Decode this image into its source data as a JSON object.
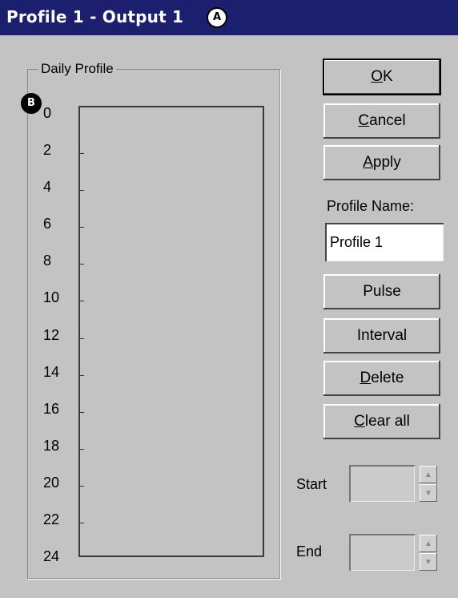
{
  "window": {
    "title": "Profile 1 - Output 1",
    "callout_a": "A",
    "callout_b": "B"
  },
  "daily_profile": {
    "label": "Daily Profile",
    "hours": [
      "0",
      "2",
      "4",
      "6",
      "8",
      "10",
      "12",
      "14",
      "16",
      "18",
      "20",
      "22",
      "24"
    ]
  },
  "buttons": {
    "ok": {
      "mnemonic": "O",
      "rest": "K"
    },
    "cancel": {
      "mnemonic": "C",
      "rest": "ancel"
    },
    "apply": {
      "mnemonic": "A",
      "rest": "pply"
    },
    "pulse": "Pulse",
    "interval": "Interval",
    "delete": {
      "mnemonic": "D",
      "rest": "elete"
    },
    "clear_all": {
      "mnemonic": "C",
      "rest": "lear all"
    }
  },
  "profile_name": {
    "label": "Profile Name:",
    "value": "Profile 1"
  },
  "time_range": {
    "start_label": "Start",
    "end_label": "End",
    "start_value": "",
    "end_value": ""
  },
  "icons": {
    "spin_up": "up-arrow",
    "spin_down": "down-arrow"
  },
  "colors": {
    "titlebar": "#1c1f6e",
    "dialog_bg": "#c3c3c3"
  }
}
